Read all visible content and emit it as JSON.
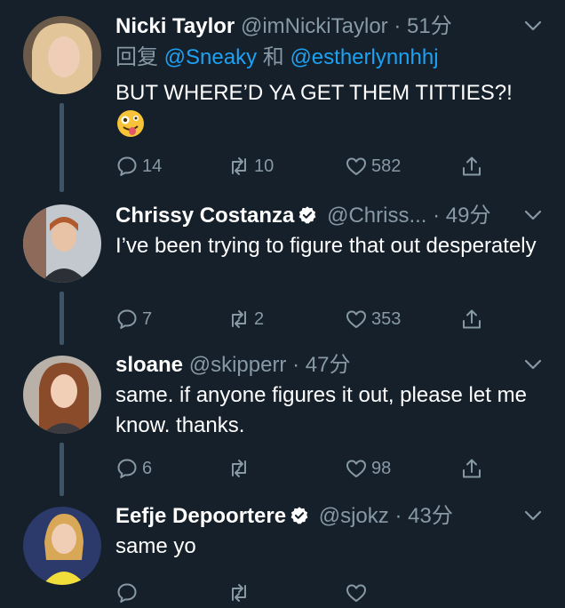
{
  "tweets": [
    {
      "name": "Nicki Taylor",
      "handle": "@imNickiTaylor",
      "dot": "·",
      "time": "51分",
      "replying_prefix": "回复",
      "mention1": "@Sneaky",
      "replying_and": "和",
      "mention2": "@estherlynnhhj",
      "text": "BUT WHERE’D YA GET THEM TITTIES?!",
      "emoji": "zany-face",
      "replies": "14",
      "retweets": "10",
      "likes": "582"
    },
    {
      "name": "Chrissy Costanza",
      "handle": "@Chriss...",
      "dot": "·",
      "time": "49分",
      "verified": true,
      "text": "I’ve been trying to figure that out desperately",
      "replies": "7",
      "retweets": "2",
      "likes": "353"
    },
    {
      "name": "sloane",
      "handle": "@skipperr",
      "dot": "·",
      "time": "47分",
      "text": "same. if anyone figures it out, please let me know. thanks.",
      "replies": "6",
      "retweets": "",
      "likes": "98"
    },
    {
      "name": "Eefje Depoortere",
      "handle": "@sjokz",
      "dot": "·",
      "time": "43分",
      "verified": true,
      "text": "same yo"
    }
  ],
  "colors": {
    "background": "#15202b",
    "secondary_text": "#8899a6",
    "link": "#1da1f2",
    "verified": "#ffffff"
  }
}
